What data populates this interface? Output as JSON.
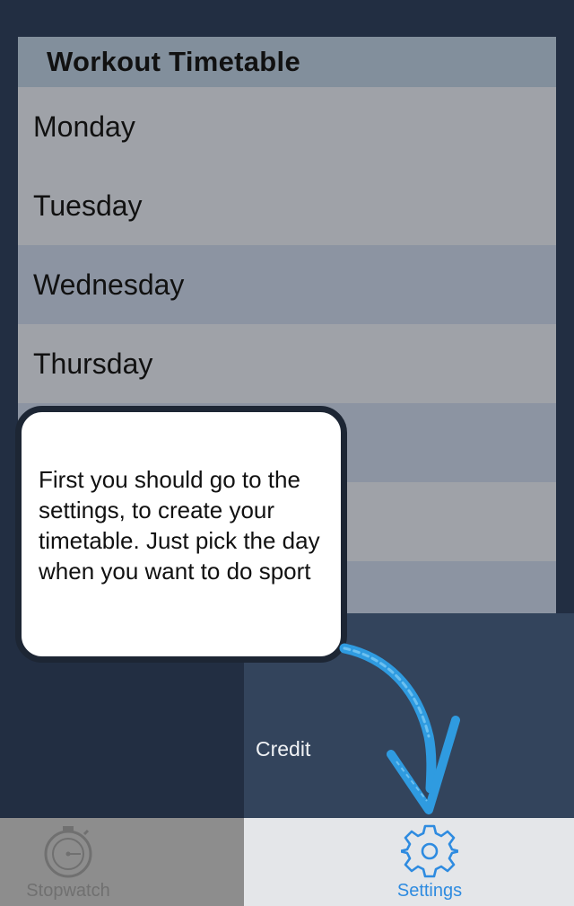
{
  "timetable": {
    "title": "Workout Timetable",
    "days": [
      "Monday",
      "Tuesday",
      "Wednesday",
      "Thursday",
      "",
      ""
    ]
  },
  "credit_panel": {
    "label": "Credit"
  },
  "tooltip": {
    "text": "First you should go to the settings, to create your timetable. Just pick the day when you want to do sport"
  },
  "tab_bar": {
    "tabs": [
      {
        "label": "Stopwatch",
        "icon": "stopwatch-icon",
        "active": false
      },
      {
        "label": "Settings",
        "icon": "gear-icon",
        "active": true
      }
    ]
  },
  "colors": {
    "background": "#222e42",
    "active_tab": "#2e8be0",
    "arrow": "#2f9be0"
  }
}
